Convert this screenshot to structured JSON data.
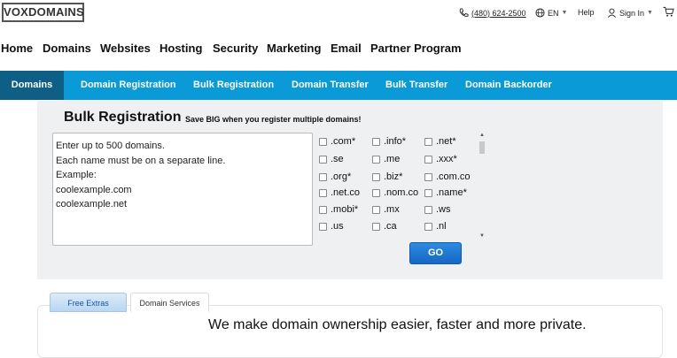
{
  "header": {
    "logo": "VOXDOMAINS",
    "phone": "(480) 624-2500",
    "language": "EN",
    "help": "Help",
    "sign_in": "Sign In"
  },
  "main_nav": [
    "Home",
    "Domains",
    "Websites",
    "Hosting",
    "Security",
    "Marketing",
    "Email",
    "Partner Program"
  ],
  "sub_nav": {
    "active": "Domains",
    "items": [
      "Domain Registration",
      "Bulk Registration",
      "Domain Transfer",
      "Bulk Transfer",
      "Domain Backorder"
    ]
  },
  "bulk": {
    "title": "Bulk Registration",
    "subtitle": "Save BIG when you register multiple domains!",
    "textarea_lines": [
      "Enter up to 500 domains.",
      "Each name must be on a separate line.",
      "Example:",
      "coolexample.com",
      "coolexample.net"
    ],
    "tlds": [
      [
        ".com*",
        ".info*",
        ".net*"
      ],
      [
        ".se",
        ".me",
        ".xxx*"
      ],
      [
        ".org*",
        ".biz*",
        ".com.co"
      ],
      [
        ".net.co",
        ".nom.co",
        ".name*"
      ],
      [
        ".mobi*",
        ".mx",
        ".ws"
      ],
      [
        ".us",
        ".ca",
        ".nl"
      ]
    ],
    "go_label": "GO"
  },
  "tabs": {
    "free_extras": "Free Extras",
    "domain_services": "Domain Services"
  },
  "card": {
    "headline": "We make domain ownership easier, faster and more private."
  },
  "colors": {
    "subnav_bg": "#0a9ad8",
    "subnav_active": "#0e5e85",
    "go_button": "#1f78d1",
    "panel_bg": "#eef0f1"
  }
}
